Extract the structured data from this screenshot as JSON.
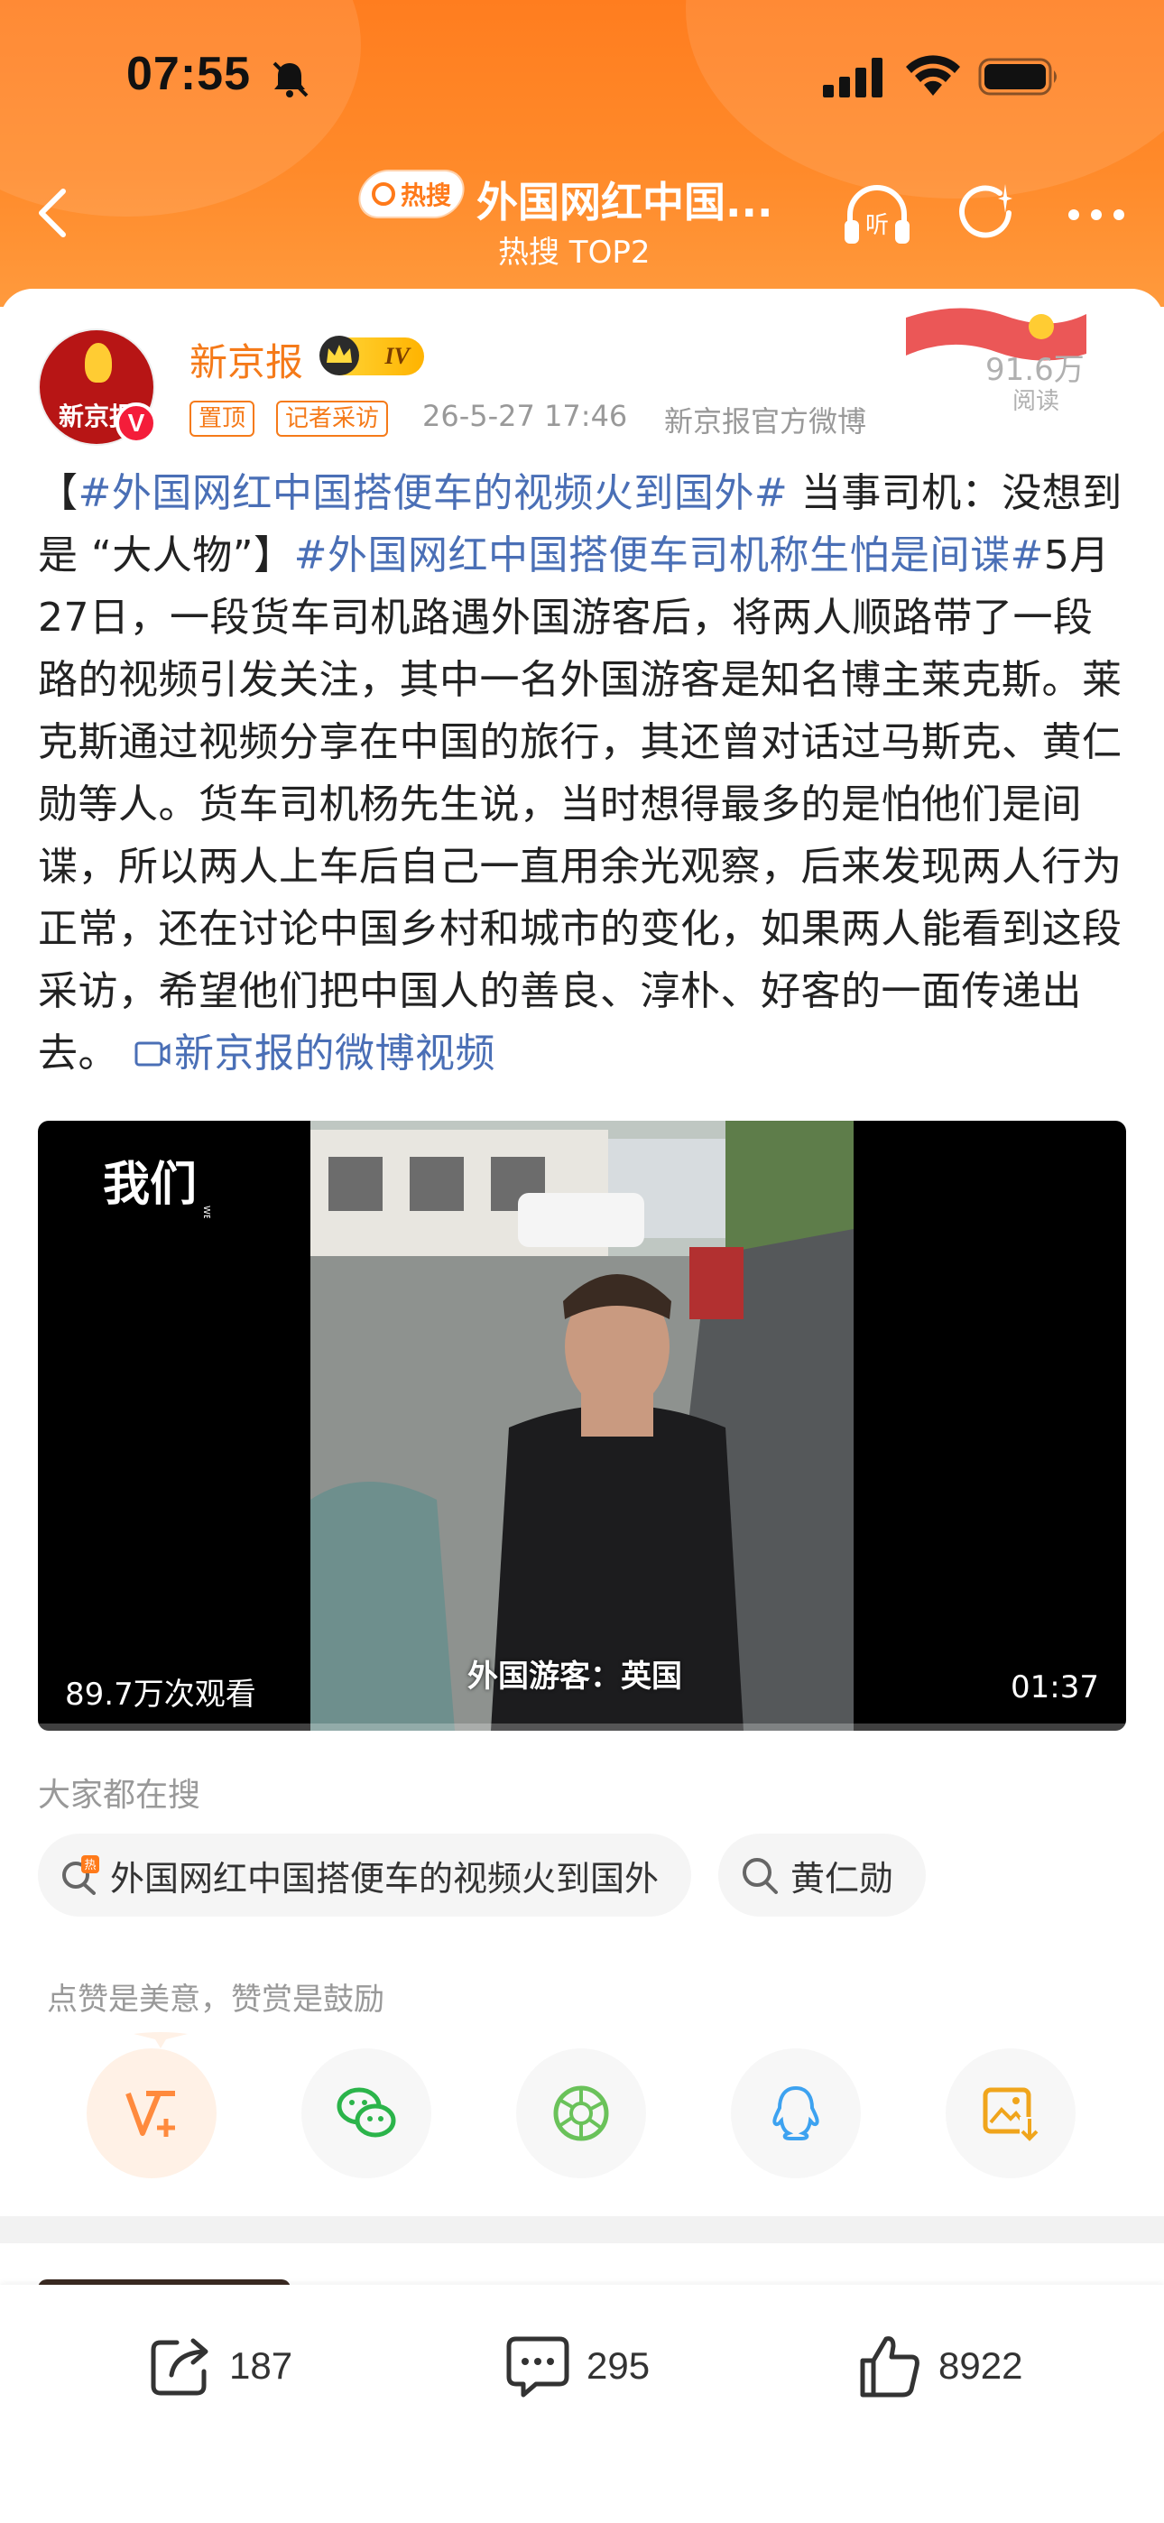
{
  "status_bar": {
    "time": "07:55"
  },
  "nav": {
    "hot_badge": "热搜",
    "title": "外国网红中国...",
    "subtitle": "热搜 TOP2"
  },
  "post": {
    "author": "新京报",
    "avatar_text": "新京报",
    "verified_mark": "V",
    "level": "IV",
    "tags": [
      "置顶",
      "记者采访"
    ],
    "time": "26-5-27 17:46",
    "source": "新京报官方微博",
    "read_count": "91.6万",
    "read_label": "阅读",
    "text": {
      "p1_open": "【",
      "topic1": "#外国网红中国搭便车的视频火到国外#",
      "p1_rest": " 当事司机：没想到是 “大人物”】",
      "topic2": "#外国网红中国搭便车司机称生怕是间谍#",
      "p2": "5月27日，一段货车司机路遇外国游客后，将两人顺路带了一段路的视频引发关注，其中一名外国游客是知名博主莱克斯。莱克斯通过视频分享在中国的旅行，其还曾对话过马斯克、黄仁勋等人。货车司机杨先生说，当时想得最多的是怕他们是间谍，所以两人上车后自己一直用余光观察，后来发现两人行为正常，还在讨论中国乡村和城市的变化，如果两人能看到这段采访，希望他们把中国人的善良、淳朴、好客的一面传递出去。",
      "video_link": "新京报的微博视频"
    }
  },
  "video": {
    "brand": "我们",
    "brand_sub": "WEVIDEO",
    "views": "89.7万次观看",
    "caption": "外国游客：英国",
    "duration": "01:37"
  },
  "searches": {
    "title": "大家都在搜",
    "items": [
      {
        "label": "外国网红中国搭便车的视频火到国外",
        "icon": "hot-search-icon"
      },
      {
        "label": "黄仁勋",
        "icon": "search-icon"
      }
    ]
  },
  "reward_tip": "点赞是美意，赞赏是鼓励",
  "share": {
    "items": [
      {
        "icon": "reward-v-plus-icon"
      },
      {
        "icon": "wechat-icon"
      },
      {
        "icon": "moments-icon"
      },
      {
        "icon": "qq-icon"
      },
      {
        "icon": "save-image-icon"
      }
    ]
  },
  "bottom_bar": {
    "repost_count": "187",
    "comment_count": "295",
    "like_count": "8922"
  },
  "colors": {
    "header": "#ff7d1f",
    "accent": "#f57a19",
    "link": "#4a6fb6"
  }
}
